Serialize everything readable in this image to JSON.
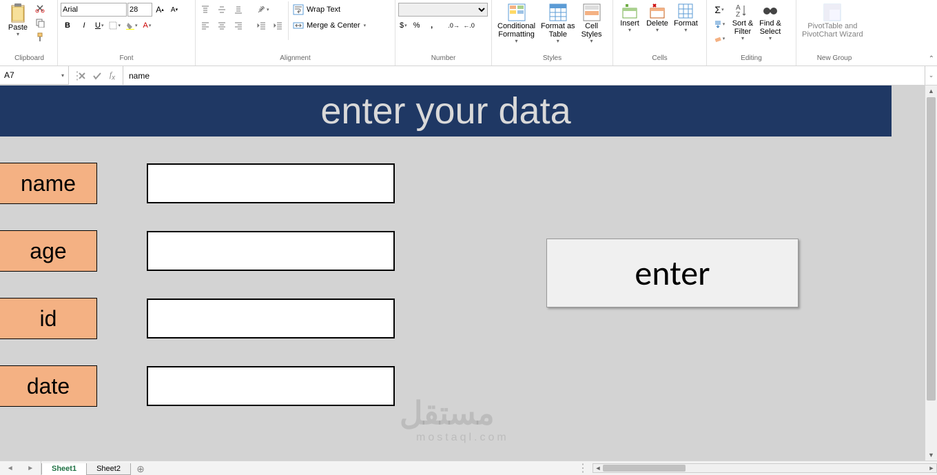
{
  "ribbon": {
    "clipboard": {
      "label": "Clipboard",
      "paste": "Paste"
    },
    "font": {
      "label": "Font",
      "name": "Arial",
      "size": "28"
    },
    "alignment": {
      "label": "Alignment",
      "wrap": "Wrap Text",
      "merge": "Merge & Center"
    },
    "number": {
      "label": "Number"
    },
    "styles": {
      "label": "Styles",
      "cond": "Conditional\nFormatting",
      "table": "Format as\nTable",
      "cell": "Cell\nStyles"
    },
    "cells": {
      "label": "Cells",
      "insert": "Insert",
      "delete": "Delete",
      "format": "Format"
    },
    "editing": {
      "label": "Editing",
      "sort": "Sort &\nFilter",
      "find": "Find &\nSelect"
    },
    "newgroup": {
      "label": "New Group",
      "pivot": "PivotTable and\nPivotChart Wizard"
    }
  },
  "formulaBar": {
    "cellRef": "A7",
    "formula": "name"
  },
  "form": {
    "title": "enter your data",
    "labels": [
      "name",
      "age",
      "id",
      "date"
    ],
    "button": "enter"
  },
  "tabs": {
    "sheets": [
      "Sheet1",
      "Sheet2"
    ],
    "active": 0
  },
  "watermark": {
    "main": "مستقل",
    "sub": "mostaql.com"
  }
}
